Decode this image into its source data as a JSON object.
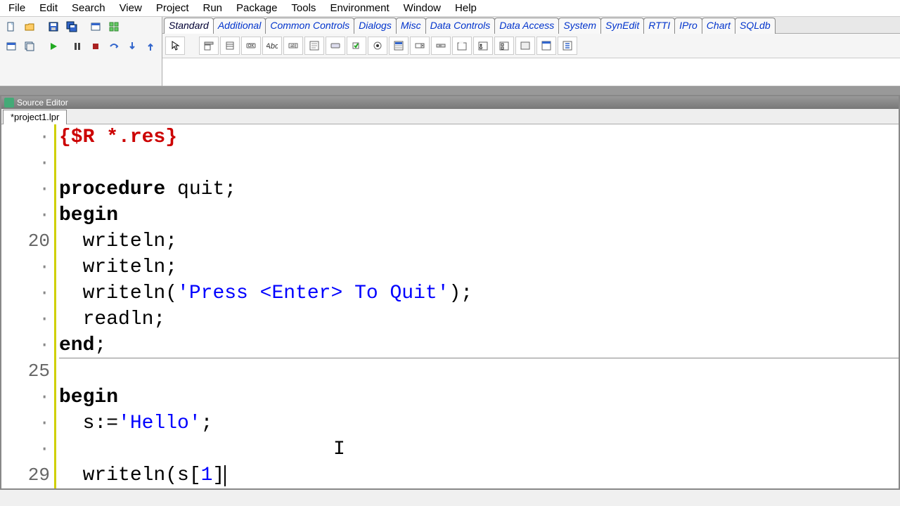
{
  "menu": [
    "File",
    "Edit",
    "Search",
    "View",
    "Project",
    "Run",
    "Package",
    "Tools",
    "Environment",
    "Window",
    "Help"
  ],
  "toolbar1_icons": [
    "new-unit",
    "open",
    "save",
    "save-all",
    "view-form",
    "view-units"
  ],
  "toolbar2_icons": [
    "new-form",
    "open-project",
    "run",
    "pause",
    "stop",
    "step-into",
    "step-over",
    "step-out"
  ],
  "component_tabs": [
    "Standard",
    "Additional",
    "Common Controls",
    "Dialogs",
    "Misc",
    "Data Controls",
    "Data Access",
    "System",
    "SynEdit",
    "RTTI",
    "IPro",
    "Chart",
    "SQLdb"
  ],
  "active_component_tab": "Standard",
  "palette_icons": [
    "pointer",
    "mainmenu",
    "popupmenu",
    "button",
    "label",
    "edit",
    "memo",
    "togglebox",
    "checkbox",
    "radiobutton",
    "listbox",
    "combobox",
    "scrollbar",
    "groupbox",
    "radiogroup",
    "checkgroup",
    "panel",
    "frame",
    "actionlist"
  ],
  "editor_title": "Source Editor",
  "editor_tab": "*project1.lpr",
  "code": {
    "l1_directive": "{$R *.res}",
    "l3_kw": "procedure",
    "l3_id": " quit;",
    "l4": "begin",
    "l5_id": "  writeln;",
    "l6_id": "  writeln;",
    "l7_a": "  writeln(",
    "l7_str": "'Press <Enter> To Quit'",
    "l7_b": ");",
    "l8": "  readln;",
    "l9": "end",
    "l9b": ";",
    "l11": "begin",
    "l12_a": "  s:=",
    "l12_str": "'Hello'",
    "l12_b": ";",
    "l14_a": "  writeln(s[",
    "l14_num": "1",
    "l14_b": "]"
  },
  "line_numbers": {
    "n20": "20",
    "n25": "25",
    "n29": "29"
  }
}
